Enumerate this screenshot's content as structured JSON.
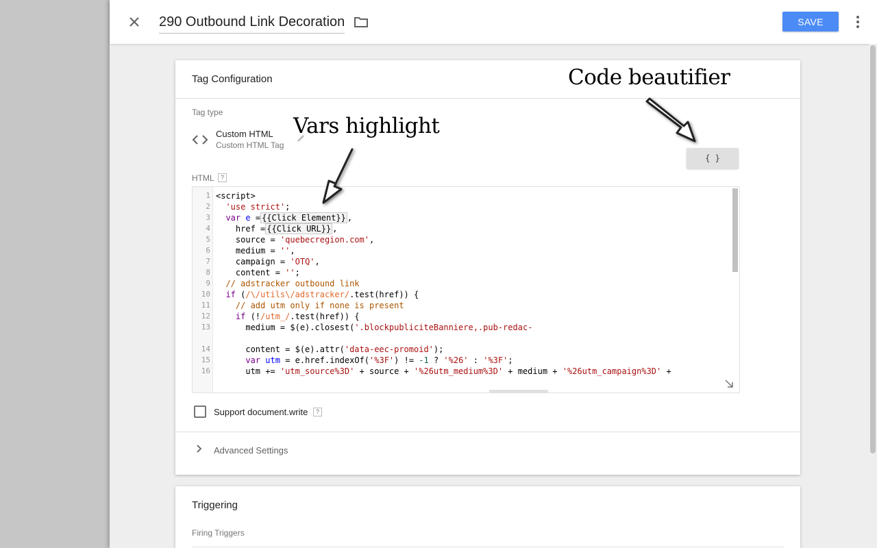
{
  "header": {
    "title": "290 Outbound Link Decoration",
    "save_label": "SAVE"
  },
  "config": {
    "title": "Tag Configuration",
    "tag_type_label": "Tag type",
    "tag_type_name": "Custom HTML",
    "tag_type_sub": "Custom HTML Tag",
    "html_label": "HTML",
    "help_glyph": "?",
    "beautify_label": "{ }",
    "support_label": "Support document.write",
    "advanced_label": "Advanced Settings"
  },
  "code": {
    "line_numbers": [
      "1",
      "2",
      "3",
      "4",
      "5",
      "6",
      "7",
      "8",
      "9",
      "10",
      "11",
      "12",
      "13",
      "14",
      "15",
      "16"
    ]
  },
  "triggering": {
    "title": "Triggering",
    "firing_label": "Firing Triggers"
  },
  "annotations": {
    "beautifier": "Code beautifier",
    "vars": "Vars highlight"
  },
  "colors": {
    "accent": "#4c8bf5",
    "keyword": "#770088",
    "string": "#aa1111",
    "comment": "#aa5500"
  }
}
